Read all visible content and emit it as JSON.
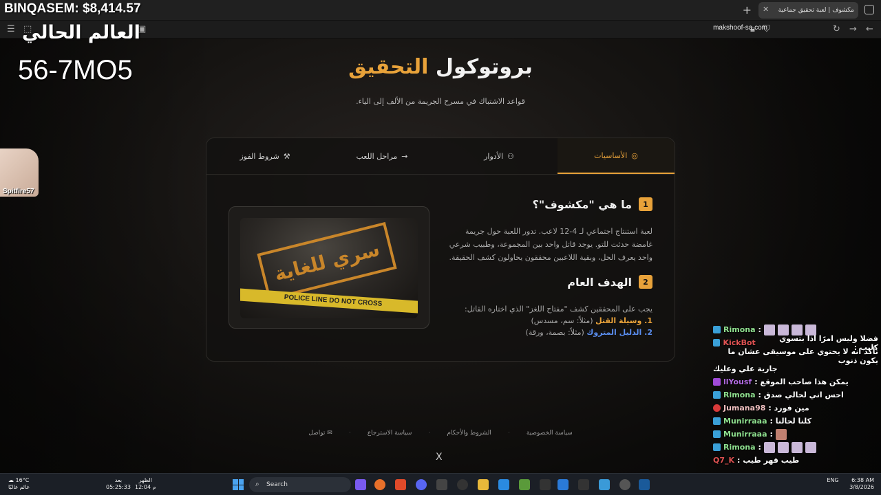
{
  "overlay": {
    "money": "BINQASEM: $8,414.57",
    "world": "العالم الحالي",
    "code": "56-7MO5",
    "cam_name": "Spitfire57"
  },
  "browser": {
    "tab_title": "مكشوف | لعبة تحقيق جماعية",
    "url": "makshoof-sa.com"
  },
  "hero": {
    "title_main": "بروتوكول",
    "title_accent": "التحقيق",
    "subtitle": "قواعد الاشتباك في مسرح الجريمة من الألف إلى الياء."
  },
  "tabs": [
    {
      "label": "الأساسيات",
      "icon": "target-icon"
    },
    {
      "label": "الأدوار",
      "icon": "users-icon"
    },
    {
      "label": "مراحل اللعب",
      "icon": "arrow-icon"
    },
    {
      "label": "شروط الفوز",
      "icon": "gavel-icon"
    }
  ],
  "section1": {
    "num": "1",
    "title": "ما هي \"مكشوف\"؟",
    "body": "لعبة استنتاج اجتماعي لـ 4-12 لاعب. تدور اللعبة حول جريمة غامضة حدثت للتو. يوجد قاتل واحد بين المجموعة، وطبيب شرعي واحد يعرف الحل، وبقية اللاعبين محققون يحاولون كشف الحقيقة."
  },
  "section2": {
    "num": "2",
    "title": "الهدف العام",
    "intro": "يجب على المحققين كشف \"مفتاح اللغز\" الذي اختاره القاتل:",
    "item1_label": "1. وسيلة القتل",
    "item1_rest": " (مثلاً: سم، مسدس)",
    "item2_label": "2. الدليل المتروك",
    "item2_rest": " (مثلاً: بصمة، ورقة)"
  },
  "image": {
    "stamp": "سري للغاية",
    "tape": "POLICE LINE DO NOT CROSS"
  },
  "footer": {
    "privacy": "سياسة الخصوصية",
    "terms": "الشروط والأحكام",
    "refund": "سياسة الاسترجاع",
    "contact": "تواصل",
    "x": "X"
  },
  "chat": [
    {
      "user": "Rimona",
      "text": "",
      "emotes": 4
    },
    {
      "user": "KickBot",
      "text": "فضلا وليس امرًا اذا بتسوي كليب :",
      "emotes": 0
    },
    {
      "user": "",
      "text": "تأكد انه لا يحتوي على موسيقى عشان ما يكون ذنوب",
      "emotes": 0
    },
    {
      "user": "",
      "text": "جارية علي وعليك",
      "emotes": 0
    },
    {
      "user": "llYousf",
      "text": "يمكن هذا صاحب الموقع :",
      "emotes": 0
    },
    {
      "user": "Rimona",
      "text": "احس اني لحالي صدق :",
      "emotes": 0
    },
    {
      "user": "Jumana98",
      "text": "مين فورد :",
      "emotes": 0
    },
    {
      "user": "Munirraaa",
      "text": "كلنا لحالنا :",
      "emotes": 0
    },
    {
      "user": "Munirraaa",
      "text": "",
      "emotes": 1
    },
    {
      "user": "Rimona",
      "text": "",
      "emotes": 4
    },
    {
      "user": "Q7_K",
      "text": "طيب قهر طيب :",
      "emotes": 0
    }
  ],
  "taskbar": {
    "temp": "16°C",
    "weather": "غائم غالبًا",
    "t1_label": "بعد",
    "t1_time": "05:25:33",
    "t2_label": "الظهر",
    "t2_time": "12:04 م",
    "search": "Search",
    "lang": "ENG",
    "clock": "6:38 AM",
    "date": "3/8/2026"
  }
}
